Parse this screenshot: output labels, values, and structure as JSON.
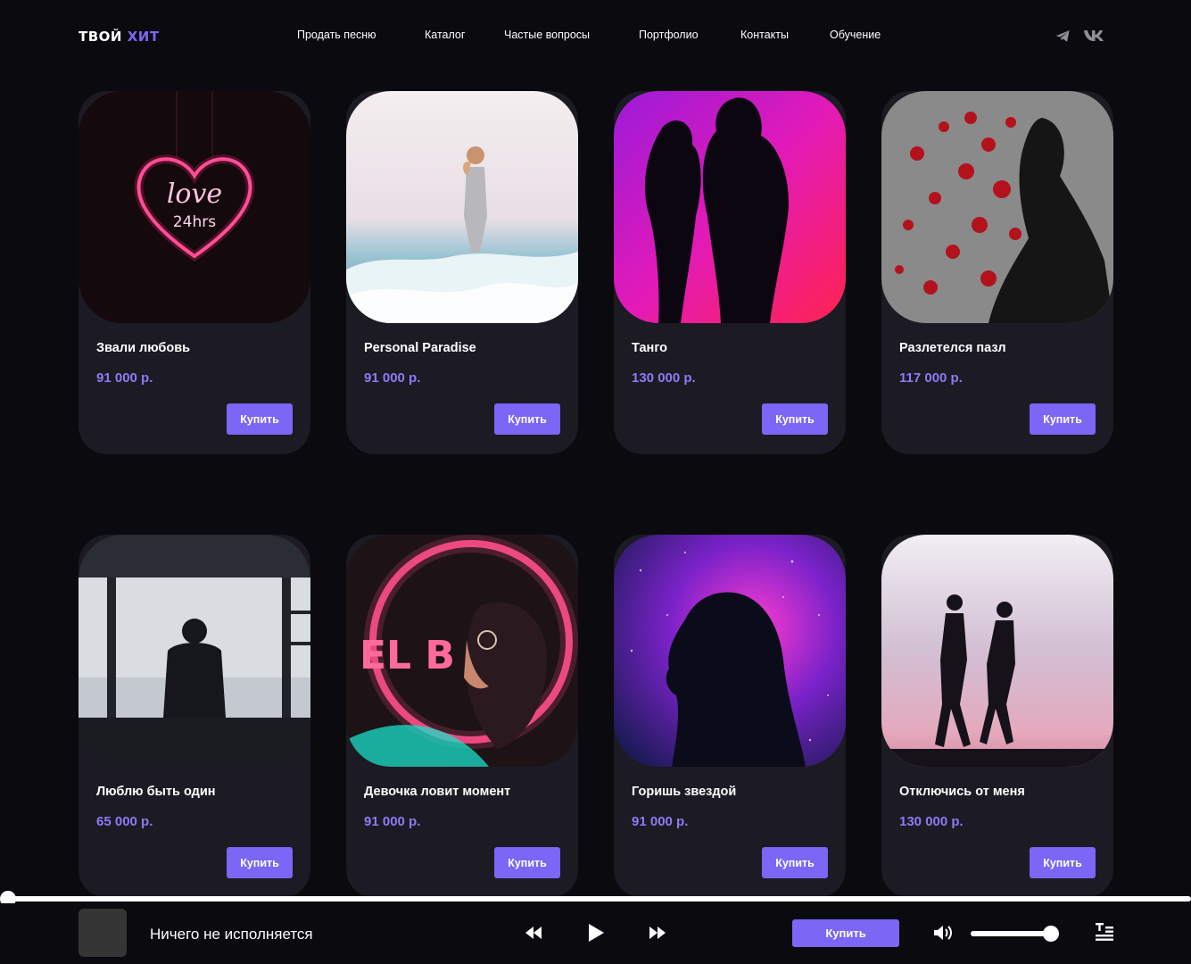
{
  "header": {
    "logo_main": "ТВОЙ",
    "logo_accent": "ХИТ",
    "nav": [
      "Продать песню",
      "Каталог",
      "Частые вопросы",
      "Портфолио",
      "Контакты",
      "Обучение"
    ],
    "social_icons": [
      "telegram-icon",
      "vk-icon"
    ]
  },
  "colors": {
    "background": "#0b0a0e",
    "card": "#1c1a22",
    "accent": "#7b66f5",
    "price": "#8c7bf7"
  },
  "catalog": {
    "buy_label": "Купить",
    "items": [
      {
        "title": "Звали любовь",
        "price": "91 000 р."
      },
      {
        "title": "Personal Paradise",
        "price": "91 000 р."
      },
      {
        "title": "Танго",
        "price": "130 000 р."
      },
      {
        "title": "Разлетелся пазл",
        "price": "117 000 р."
      },
      {
        "title": "Люблю быть один",
        "price": "65 000 р."
      },
      {
        "title": "Девочка ловит момент",
        "price": "91 000 р."
      },
      {
        "title": "Горишь звездой",
        "price": "91 000 р."
      },
      {
        "title": "Отключись от меня",
        "price": "130 000 р."
      }
    ]
  },
  "player": {
    "now_playing": "Ничего не исполняется",
    "buy_label": "Купить",
    "progress": 0,
    "volume": 0.88
  }
}
